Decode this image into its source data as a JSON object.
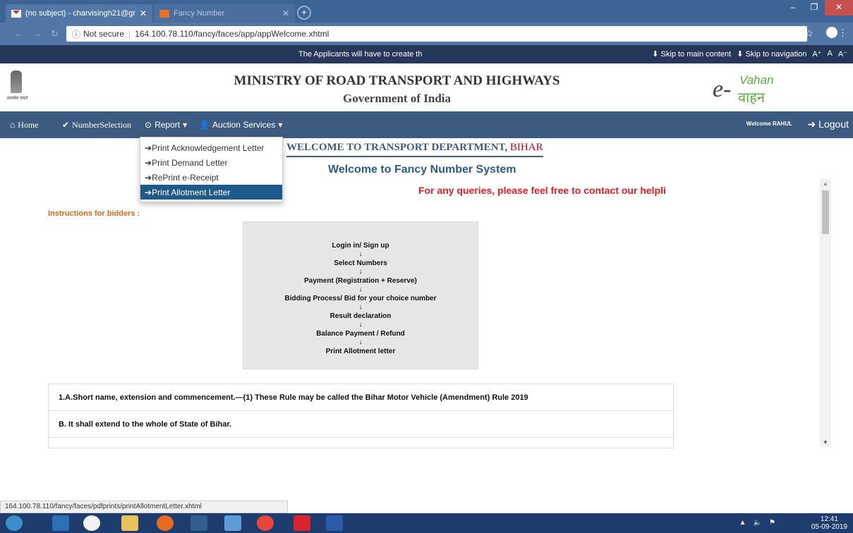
{
  "browser": {
    "tabs": [
      {
        "title": "(no subject) - charvisingh21@gm"
      },
      {
        "title": "Fancy Number"
      }
    ],
    "address": {
      "security": "Not secure",
      "url": "164.100.78.110/fancy/faces/app/appWelcome.xhtml"
    },
    "status_url": "164.100.78.110/fancy/faces/pdfprints/printAllotmentLetter.xhtml"
  },
  "infobar": {
    "marquee": "The Applicants will have to create th",
    "skip_main": "Skip to main content",
    "skip_nav": "Skip to navigation",
    "font_increase": "A⁺",
    "font_normal": "A",
    "font_decrease": "A⁻"
  },
  "header": {
    "emblem_caption": "सत्यमेव जयते",
    "title": "MINISTRY OF ROAD TRANSPORT AND HIGHWAYS",
    "subtitle": "Government of India",
    "logo_e": "e-",
    "logo_vahan": "Vahan",
    "logo_hindi": "वाहन"
  },
  "nav": {
    "home": "Home",
    "number_selection": "NumberSelection",
    "report": "Report",
    "auction": "Auction Services",
    "welcome": "Welcome RAHUL",
    "logout": "Logout"
  },
  "report_menu": [
    "Print Acknowledgement Letter",
    "Print Demand Letter",
    "RePrint e-Receipt",
    "Print Allotment Letter"
  ],
  "content": {
    "welcome_heading": "WELCOME TO TRANSPORT DEPARTMENT,",
    "state": "BIHAR",
    "system_heading": "Welcome to Fancy Number System",
    "query_text": "For any queries, please feel free to contact our helpli",
    "instructions_label": "Instructions for bidders :",
    "flow_steps": [
      "Login in/ Sign up",
      "Select Numbers",
      "Payment (Registration + Reserve)",
      "Bidding Process/ Bid for your choice number",
      "Result declaration",
      "Balance Payment / Refund",
      "Print  Allotment letter"
    ],
    "rules": [
      "1.A.Short name, extension and commencement.—(1) These Rule may be called the Bihar Motor Vehicle (Amendment) Rule 2019",
      "B. It shall extend to the whole of State of Bihar."
    ]
  },
  "taskbar": {
    "time": "12:41",
    "date": "05-09-2019"
  },
  "colors": {
    "navbar": "#3d5a80",
    "infobar": "#26375a",
    "menu_active": "#1d5a8a",
    "query_red": "#e91c24",
    "instructions_orange": "#d26a1c"
  }
}
